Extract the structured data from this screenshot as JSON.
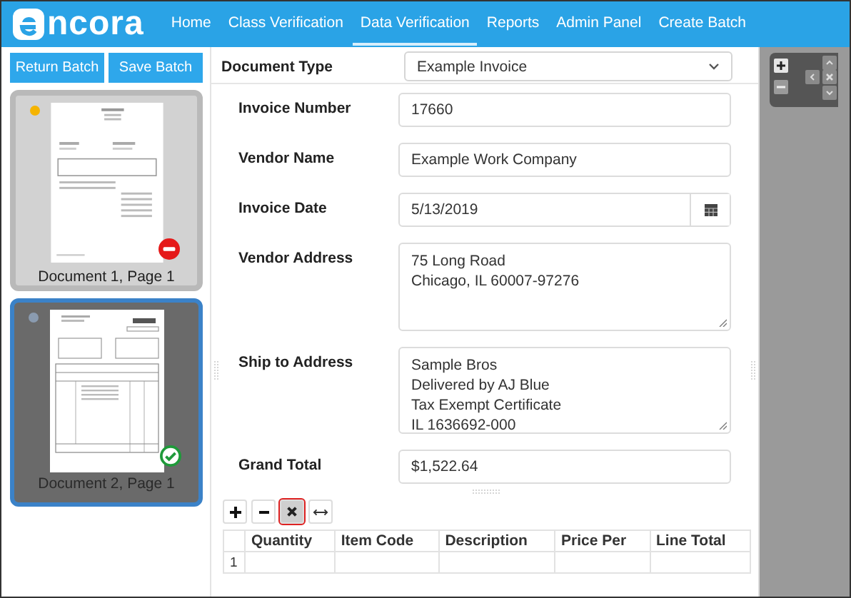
{
  "header": {
    "logo_text": "ncora",
    "nav": [
      {
        "label": "Home",
        "selected": false
      },
      {
        "label": "Class Verification",
        "selected": false
      },
      {
        "label": "Data Verification",
        "selected": true
      },
      {
        "label": "Reports",
        "selected": false
      },
      {
        "label": "Admin Panel",
        "selected": false
      },
      {
        "label": "Create Batch",
        "selected": false
      }
    ]
  },
  "sidebar": {
    "buttons": [
      "Return Batch",
      "Save Batch"
    ],
    "documents": [
      {
        "label": "Document 1, Page 1",
        "selected": false,
        "color": "#f5b400",
        "kind": "rejected"
      },
      {
        "label": "Document 2, Page 1",
        "selected": true,
        "color": "#8a9bb0",
        "kind": "approved"
      }
    ]
  },
  "form": {
    "document_type": {
      "label": "Document Type",
      "value": "Example Invoice"
    },
    "fields": [
      {
        "kind": "text",
        "label": "Invoice Number",
        "value": "17660"
      },
      {
        "kind": "text",
        "label": "Vendor Name",
        "value": "Example Work Company"
      },
      {
        "kind": "date",
        "label": "Invoice Date",
        "value": "5/13/2019"
      },
      {
        "kind": "textarea",
        "label": "Vendor Address",
        "lines": [
          "75 Long Road",
          "Chicago, IL 60007-97276"
        ]
      },
      {
        "kind": "textarea",
        "label": "Ship to Address",
        "lines": [
          "Sample Bros",
          "Delivered by AJ Blue",
          "Tax Exempt Certificate",
          "IL 1636692-000"
        ]
      },
      {
        "kind": "text",
        "label": "Grand Total",
        "value": "$1,522.64"
      }
    ]
  },
  "table_toolbar": [
    {
      "kind": "add",
      "selected": false
    },
    {
      "kind": "remove",
      "selected": false
    },
    {
      "kind": "delete",
      "selected": true
    },
    {
      "kind": "resize",
      "selected": false
    }
  ],
  "table": {
    "columns": [
      "Quantity",
      "Item Code",
      "Description",
      "Price Per",
      "Line Total"
    ],
    "rows": [
      {
        "index": "1"
      }
    ]
  }
}
